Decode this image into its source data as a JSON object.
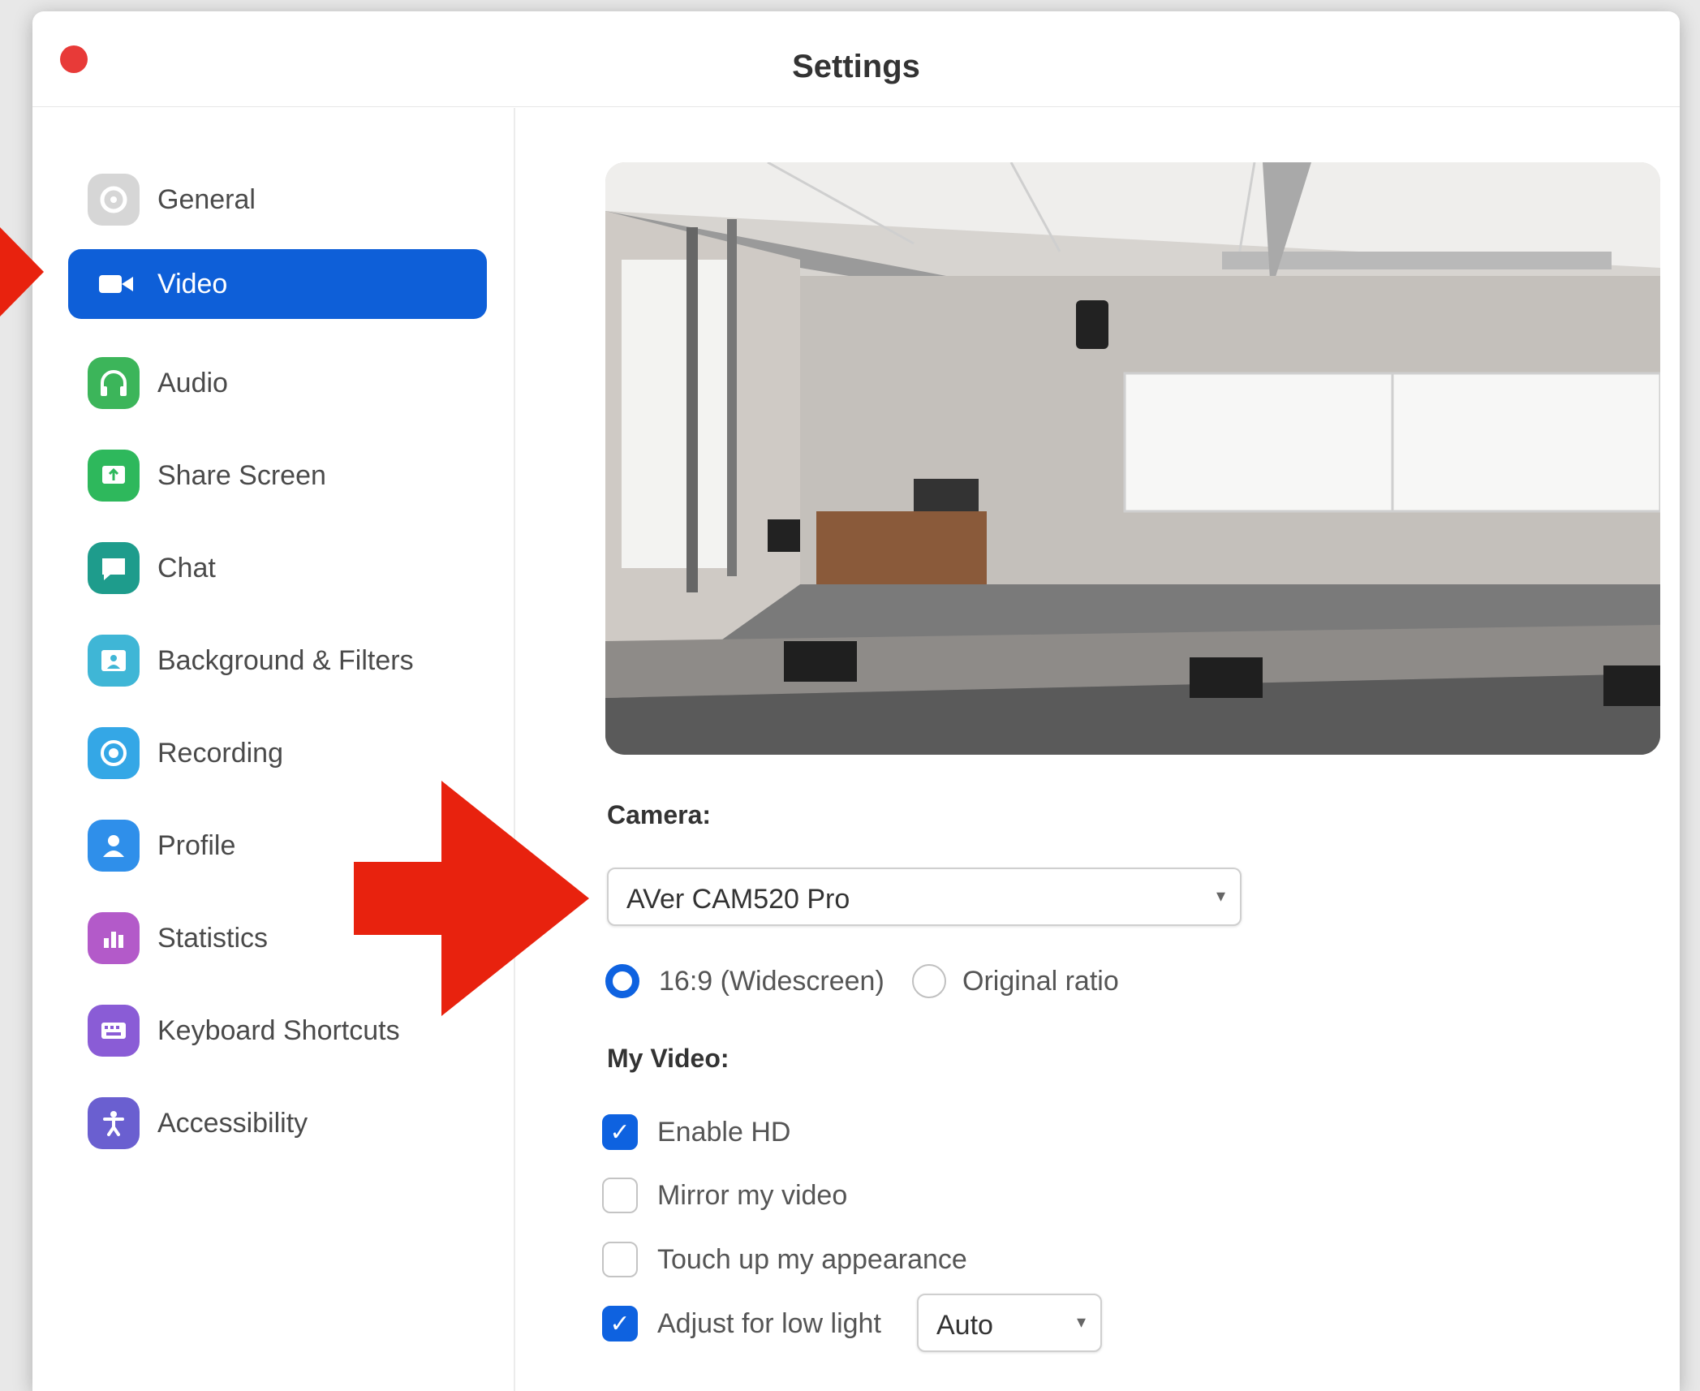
{
  "window": {
    "title": "Settings"
  },
  "sidebar": {
    "items": [
      {
        "label": "General",
        "icon": "gear-icon",
        "color": "#c8c8c8",
        "active": false
      },
      {
        "label": "Video",
        "icon": "video-camera-icon",
        "color": "#0e5fd8",
        "active": true
      },
      {
        "label": "Audio",
        "icon": "headphones-icon",
        "color": "#3cb55a",
        "active": false
      },
      {
        "label": "Share Screen",
        "icon": "share-screen-icon",
        "color": "#2eb85c",
        "active": false
      },
      {
        "label": "Chat",
        "icon": "chat-bubble-icon",
        "color": "#1e9c8c",
        "active": false
      },
      {
        "label": "Background & Filters",
        "icon": "background-icon",
        "color": "#3fb6d6",
        "active": false
      },
      {
        "label": "Recording",
        "icon": "record-icon",
        "color": "#34a7e6",
        "active": false
      },
      {
        "label": "Profile",
        "icon": "person-icon",
        "color": "#2f8fea",
        "active": false
      },
      {
        "label": "Statistics",
        "icon": "bar-chart-icon",
        "color": "#b35ac9",
        "active": false
      },
      {
        "label": "Keyboard Shortcuts",
        "icon": "keyboard-icon",
        "color": "#8a5cd6",
        "active": false
      },
      {
        "label": "Accessibility",
        "icon": "accessibility-icon",
        "color": "#6a5fd0",
        "active": false
      }
    ]
  },
  "main": {
    "camera_label": "Camera:",
    "camera_selected": "AVer CAM520 Pro",
    "aspect": {
      "options": [
        "16:9 (Widescreen)",
        "Original ratio"
      ],
      "selected": "16:9 (Widescreen)"
    },
    "my_video_label": "My Video:",
    "checkboxes": [
      {
        "label": "Enable HD",
        "checked": true
      },
      {
        "label": "Mirror my video",
        "checked": false
      },
      {
        "label": "Touch up my appearance",
        "checked": false
      },
      {
        "label": "Adjust for low light",
        "checked": true
      }
    ],
    "low_light_mode": "Auto"
  },
  "colors": {
    "accent": "#0e5fd8",
    "annotation_arrow": "#e8220e",
    "close_button": "#e83a38"
  }
}
